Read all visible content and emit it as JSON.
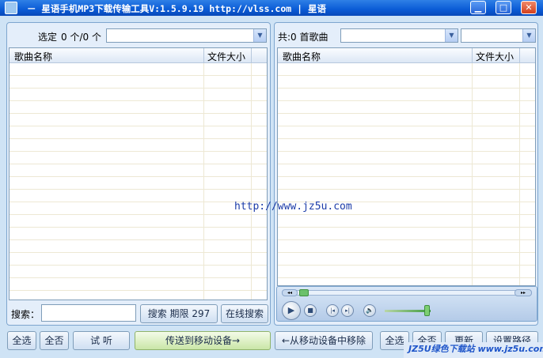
{
  "window": {
    "title": "－ 星语手机MP3下载传输工具V:1.5.9.19 http://vlss.com | 星语",
    "minimize_glyph": "▁",
    "maximize_glyph": "□",
    "close_glyph": "✕"
  },
  "left_panel": {
    "selected_label": "选定",
    "selected_count": "0 个/0 个",
    "columns": [
      "歌曲名称",
      "文件大小"
    ],
    "rows": []
  },
  "right_panel": {
    "total_label": "共:0 首歌曲",
    "columns": [
      "歌曲名称",
      "文件大小"
    ],
    "rows": []
  },
  "watermark": "http://www.jz5u.com",
  "search": {
    "label": "搜索：",
    "value": "",
    "search_button": "搜索 期限 297",
    "online_button": "在线搜索"
  },
  "player": {
    "rewind_glyph": "◂◂",
    "forward_glyph": "▸▸",
    "play_glyph": "▶",
    "stop_glyph": "■",
    "prev_glyph": "|◂",
    "next_glyph": "▸|",
    "volume_glyph": "🔈"
  },
  "bottom_left": {
    "select_all": "全选",
    "select_none": "全否",
    "preview": "试 听",
    "send": "传送到移动设备→"
  },
  "bottom_right": {
    "remove": "←从移动设备中移除",
    "select_all": "全选",
    "select_none": "全否",
    "refresh": "更新",
    "set_path": "设置路径"
  },
  "brand_watermark": "JZ5U绿色下载站 www.jz5u.com",
  "colors": {
    "titlebar": "#0a5bd6",
    "window_bg": "#cfe3f5",
    "row_line": "#ede8d4",
    "link_watermark": "#1c3ca8"
  }
}
